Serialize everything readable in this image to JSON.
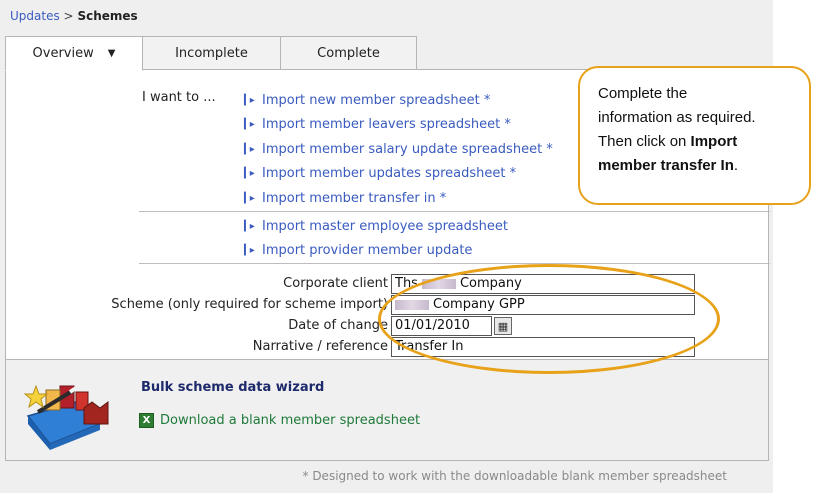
{
  "breadcrumb": {
    "parent": "Updates",
    "separator": ">",
    "current": "Schemes"
  },
  "tabs": [
    {
      "label": "Overview",
      "active": true
    },
    {
      "label": "Incomplete",
      "active": false
    },
    {
      "label": "Complete",
      "active": false
    }
  ],
  "actions": {
    "prompt": "I want to ...",
    "group1": [
      "Import new member spreadsheet *",
      "Import member leavers spreadsheet *",
      "Import member salary update spreadsheet *",
      "Import member updates spreadsheet *",
      "Import member transfer in *"
    ],
    "group2": [
      "Import master employee spreadsheet",
      "Import provider member update"
    ]
  },
  "form": {
    "corporate_client": {
      "label": "Corporate client",
      "value_prefix": "Ths",
      "value_suffix": "Company"
    },
    "scheme": {
      "label": "Scheme (only required for scheme import)",
      "value_suffix": "Company GPP"
    },
    "date_of_change": {
      "label": "Date of change",
      "value": "01/01/2010"
    },
    "narrative": {
      "label": "Narrative / reference",
      "value": "Transfer In"
    }
  },
  "wizard": {
    "title": "Bulk scheme data wizard",
    "download_link": "Download a blank member spreadsheet",
    "excel_icon_glyph": "X"
  },
  "footnote": "* Designed to work with the downloadable blank member spreadsheet",
  "callout": {
    "line1": "Complete the",
    "line2": "information as required.",
    "line3": "Then click on ",
    "bold1": "Import",
    "bold2": "member transfer In",
    "tail": "."
  },
  "colors": {
    "link": "#3a5bbf",
    "accent": "#e8a21a",
    "wizard_title": "#1e2a6b",
    "download_link": "#1f7a3a"
  }
}
